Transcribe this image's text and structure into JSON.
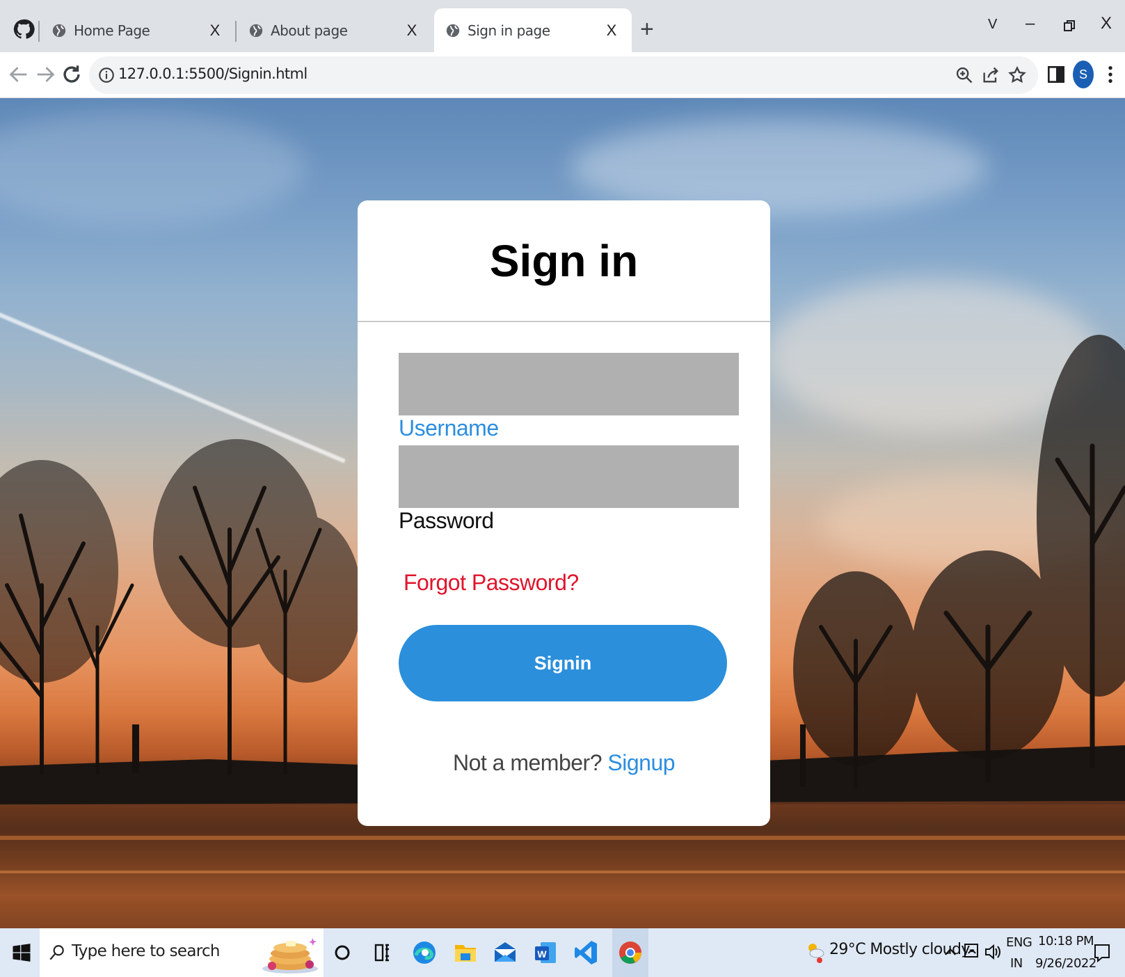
{
  "browser": {
    "tabs": [
      {
        "title": "Home Page",
        "close": "X"
      },
      {
        "title": "About page",
        "close": "X"
      },
      {
        "title": "Sign in page",
        "close": "X",
        "active": true
      }
    ],
    "new_tab": "+",
    "window_controls": {
      "tab_search": "V",
      "minimize": "–",
      "close": "X"
    },
    "url": "127.0.0.1:5500/Signin.html",
    "profile_initial": "S",
    "icons": [
      "github-icon",
      "back-icon",
      "forward-icon",
      "reload-icon",
      "info-icon",
      "zoom-icon",
      "share-icon",
      "star-icon",
      "side-panel-icon",
      "menu-icon"
    ]
  },
  "signin": {
    "title": "Sign in",
    "username_label": "Username",
    "password_label": "Password",
    "forgot": "Forgot Password?",
    "button": "Signin",
    "member_text": "Not a member?",
    "signup_link": "Signup"
  },
  "taskbar": {
    "search_placeholder": "Type here to search",
    "weather": "29°C  Mostly cloudy",
    "language": "ENG",
    "region": "IN",
    "time": "10:18 PM",
    "date": "9/26/2022",
    "apps": [
      "cortana-icon",
      "task-view-icon",
      "edge-icon",
      "file-explorer-icon",
      "mail-icon",
      "word-icon",
      "vscode-icon",
      "chrome-icon"
    ]
  },
  "colors": {
    "accent": "#2b8fdb",
    "link": "#2d8ee0",
    "danger": "#e0142c",
    "input_bg": "#b0b0b0"
  }
}
